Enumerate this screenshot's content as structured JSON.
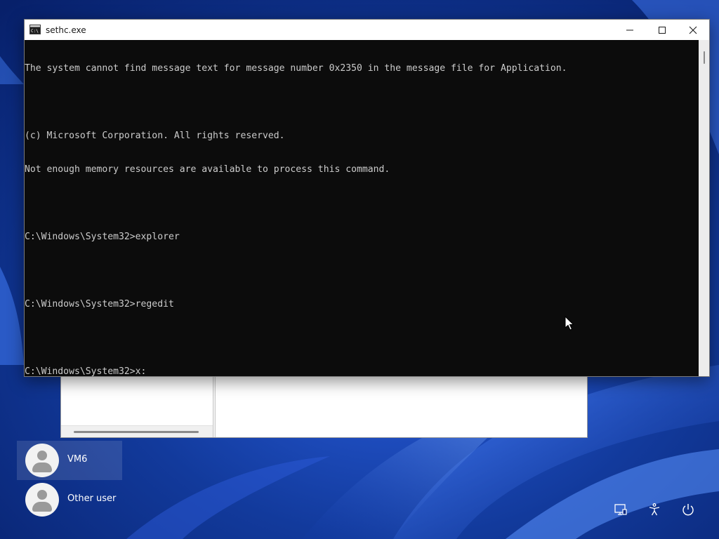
{
  "console": {
    "title": "sethc.exe",
    "lines": [
      "The system cannot find message text for message number 0x2350 in the message file for Application.",
      "",
      "(c) Microsoft Corporation. All rights reserved.",
      "Not enough memory resources are available to process this command.",
      "",
      "C:\\Windows\\System32>explorer",
      "",
      "C:\\Windows\\System32>regedit",
      "",
      "C:\\Windows\\System32>x:"
    ],
    "icon": "console-icon",
    "buttons": [
      "minimize-icon",
      "maximize-icon",
      "close-icon"
    ]
  },
  "users": [
    {
      "name": "VM6",
      "selected": true,
      "icon": "user-avatar-icon"
    },
    {
      "name": "Other user",
      "selected": false,
      "icon": "user-avatar-icon"
    }
  ],
  "system_buttons": [
    "network-icon",
    "accessibility-icon",
    "power-icon"
  ],
  "colors": {
    "console_bg": "#0c0c0c",
    "console_text": "#cccccc",
    "desktop_accent": "#1d4fd0"
  }
}
